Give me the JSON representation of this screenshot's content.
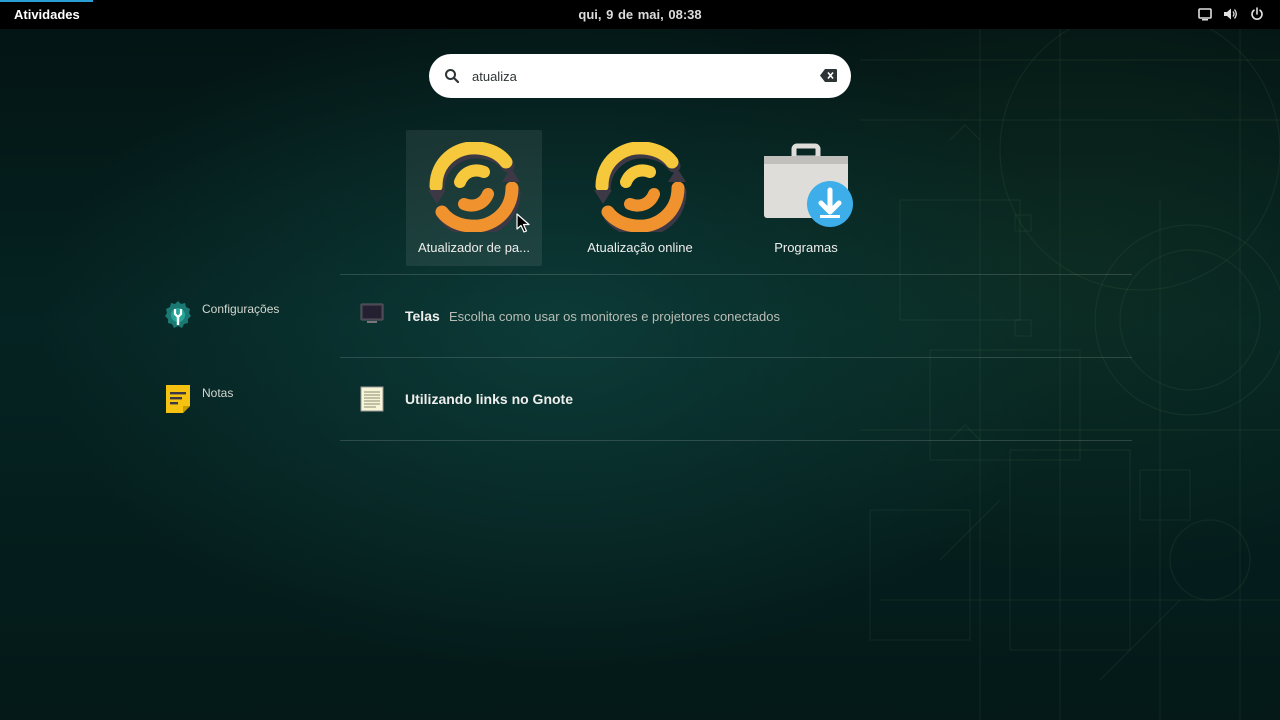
{
  "topbar": {
    "activities_label": "Atividades",
    "clock": "qui,  9 de mai, 08:38"
  },
  "tray_icons": [
    "display-icon",
    "volume-icon",
    "power-icon"
  ],
  "search": {
    "value": "atualiza",
    "icon": "search-icon",
    "clear_icon": "backspace-clear-icon"
  },
  "apps": [
    {
      "label": "Atualizador de pa...",
      "icon": "software-update-icon",
      "selected": true
    },
    {
      "label": "Atualização online",
      "icon": "software-update-icon",
      "selected": false
    },
    {
      "label": "Programas",
      "icon": "software-center-icon",
      "selected": false
    }
  ],
  "providers": [
    {
      "name": "Configurações",
      "icon": "settings-icon",
      "results": [
        {
          "title": "Telas",
          "description": "Escolha como usar os monitores e projetores conectados",
          "icon": "monitor-icon"
        }
      ]
    },
    {
      "name": "Notas",
      "icon": "notes-icon",
      "results": [
        {
          "title": "Utilizando links no Gnote",
          "description": "",
          "icon": "note-document-icon"
        }
      ]
    }
  ],
  "colors": {
    "accent": "#2a9fd6",
    "topbar": "#000000",
    "search_bg": "#ffffff",
    "update_icon_yellow": "#f6c83b",
    "update_icon_orange": "#f0932e",
    "download_badge": "#3daee9",
    "notes_yellow": "#f5c211",
    "settings_teal": "#1a7a73"
  }
}
